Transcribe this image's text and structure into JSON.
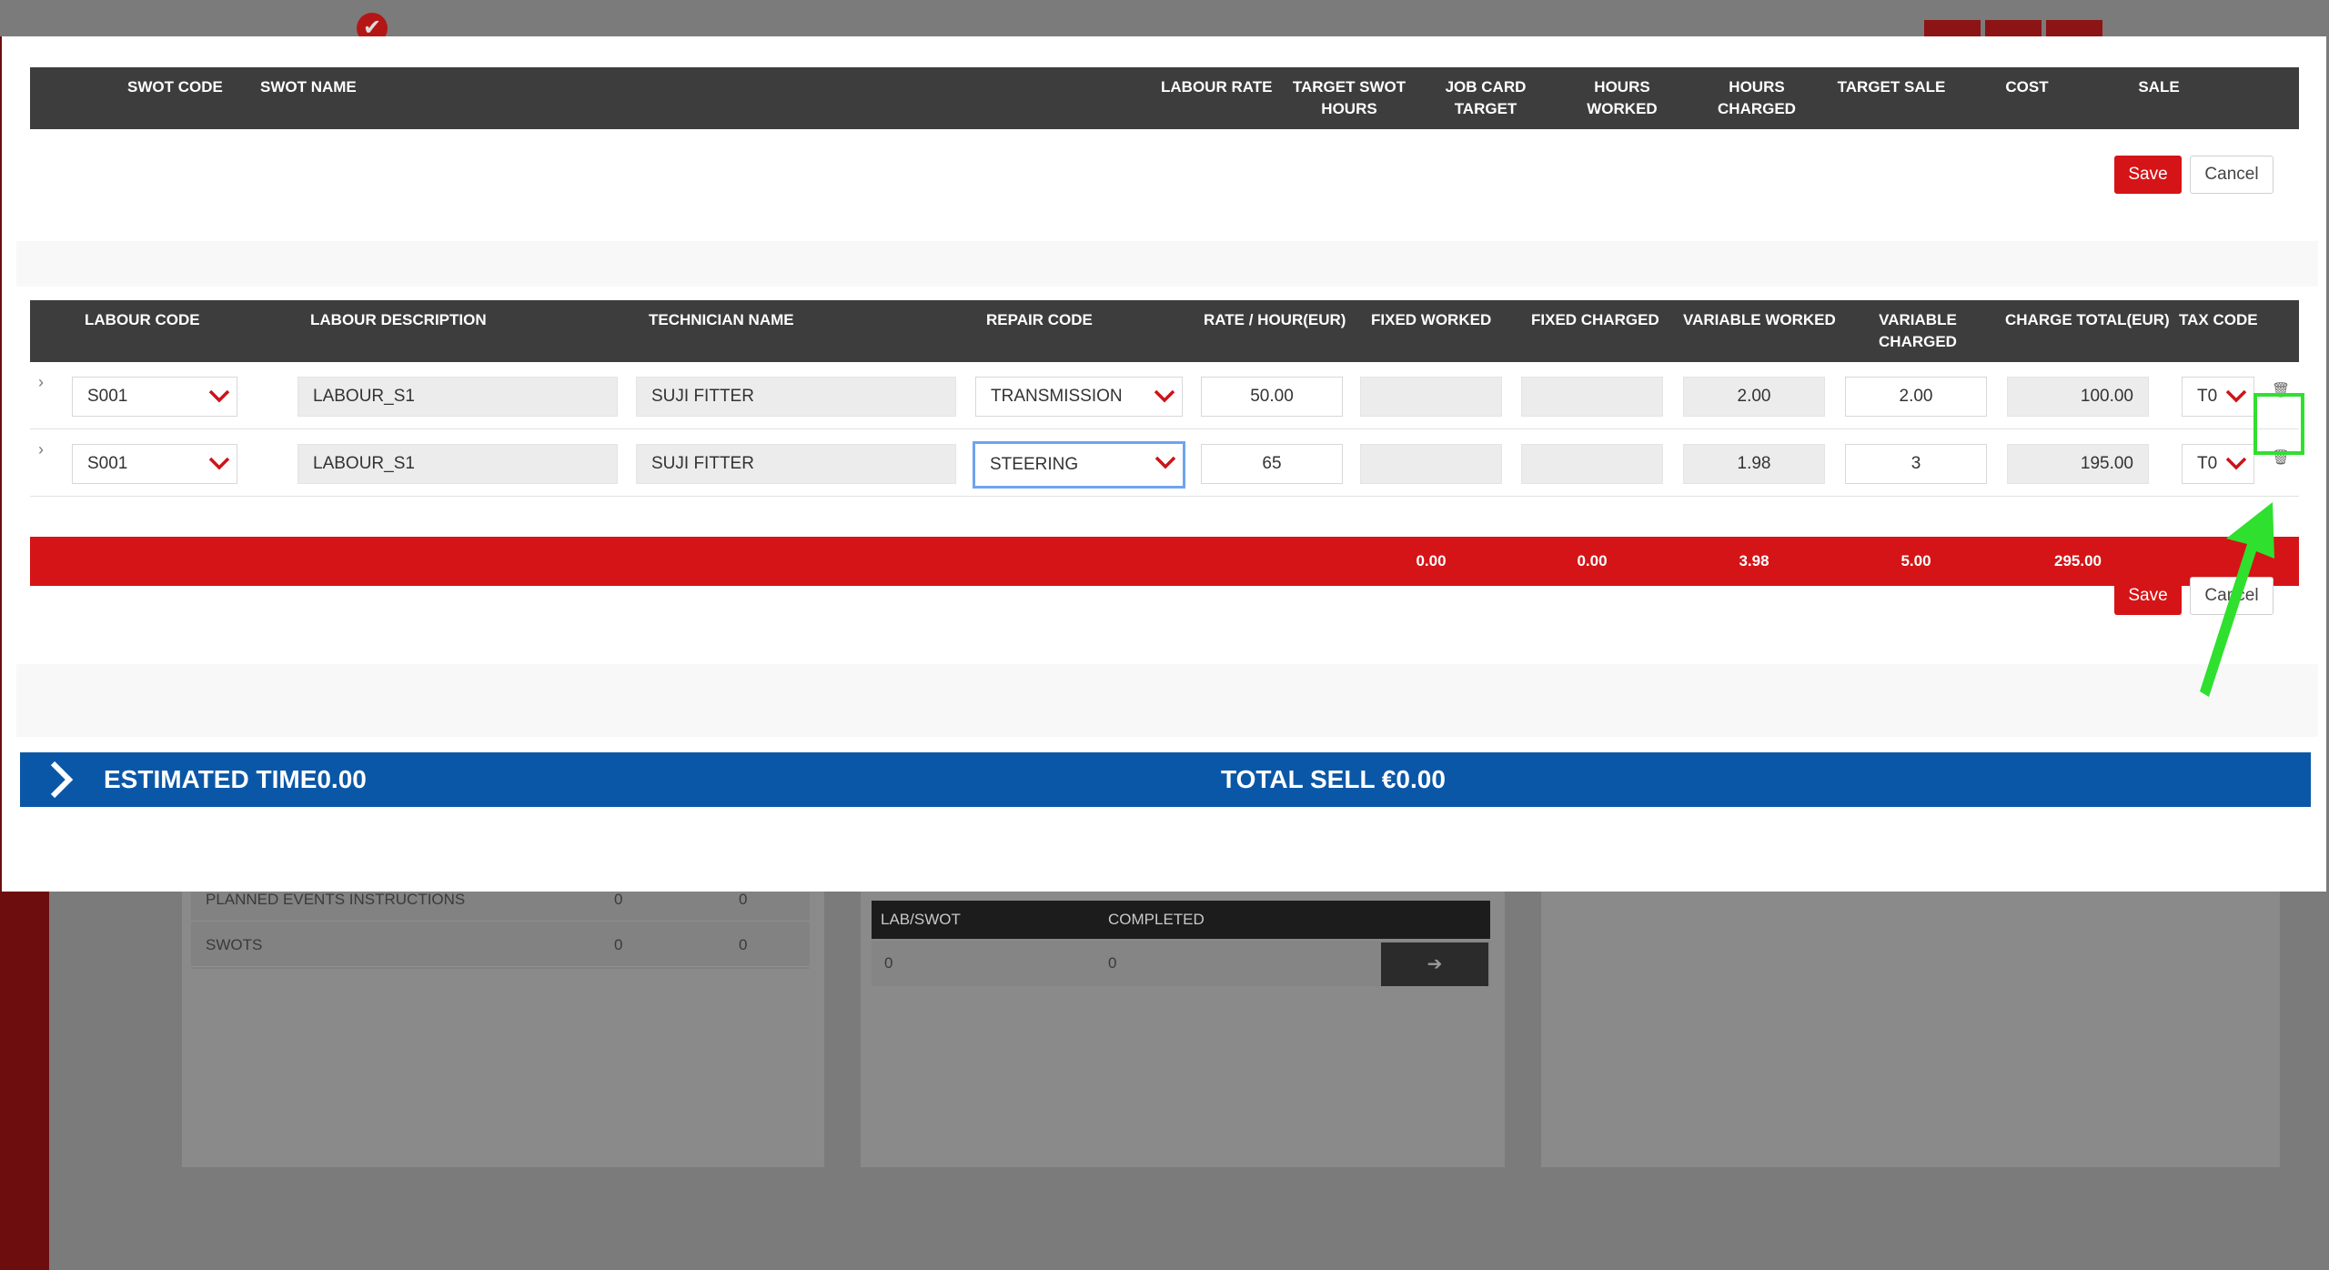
{
  "background": {
    "panel1_rows": [
      {
        "label": "PLANNED EVENTS INSTRUCTIONS",
        "a": "0",
        "b": "0"
      },
      {
        "label": "SWOTS",
        "a": "0",
        "b": "0"
      }
    ],
    "lab_table": {
      "headers": [
        "LAB/SWOT",
        "COMPLETED"
      ],
      "row": [
        "0",
        "0"
      ]
    }
  },
  "swot_table": {
    "headers": {
      "swot_code": "SWOT CODE",
      "swot_name": "SWOT NAME",
      "labour_rate": "LABOUR RATE",
      "target_swot_hours_1": "TARGET SWOT",
      "target_swot_hours_2": "HOURS",
      "job_card_target_1": "JOB CARD",
      "job_card_target_2": "TARGET",
      "hours_worked_1": "HOURS",
      "hours_worked_2": "WORKED",
      "hours_charged_1": "HOURS",
      "hours_charged_2": "CHARGED",
      "target_sale": "TARGET SALE",
      "cost": "COST",
      "sale": "SALE"
    },
    "save_label": "Save",
    "cancel_label": "Cancel"
  },
  "labour_table": {
    "headers": {
      "labour_code": "LABOUR CODE",
      "labour_description": "LABOUR DESCRIPTION",
      "technician_name": "TECHNICIAN NAME",
      "repair_code": "REPAIR CODE",
      "rate_hour": "RATE / HOUR(EUR)",
      "fixed_worked": "FIXED WORKED",
      "fixed_charged": "FIXED CHARGED",
      "variable_worked": "VARIABLE WORKED",
      "variable_charged_1": "VARIABLE",
      "variable_charged_2": "CHARGED",
      "charge_total": "CHARGE TOTAL(EUR)",
      "tax_code": "TAX CODE"
    },
    "rows": [
      {
        "labour_code": "S001",
        "labour_description": "LABOUR_S1",
        "technician_name": "SUJI FITTER",
        "repair_code": "TRANSMISSION",
        "rate": "50.00",
        "fixed_worked": "",
        "fixed_charged": "",
        "variable_worked": "2.00",
        "variable_charged": "2.00",
        "charge_total": "100.00",
        "tax_code": "T0"
      },
      {
        "labour_code": "S001",
        "labour_description": "LABOUR_S1",
        "technician_name": "SUJI FITTER",
        "repair_code": "STEERING",
        "rate": "65",
        "fixed_worked": "",
        "fixed_charged": "",
        "variable_worked": "1.98",
        "variable_charged": "3",
        "charge_total": "195.00",
        "tax_code": "T0"
      }
    ],
    "totals": {
      "fixed_worked": "0.00",
      "fixed_charged": "0.00",
      "variable_worked": "3.98",
      "variable_charged": "5.00",
      "charge_total": "295.00"
    },
    "save_label": "Save",
    "cancel_label": "Cancel"
  },
  "summary": {
    "estimated_time": "ESTIMATED TIME0.00",
    "total_sell": "TOTAL SELL €0.00"
  },
  "colors": {
    "accent_red": "#d51417",
    "header_dark": "#3d3d3d",
    "summary_blue": "#0b57a7",
    "annotation_green": "#2fe02f"
  }
}
